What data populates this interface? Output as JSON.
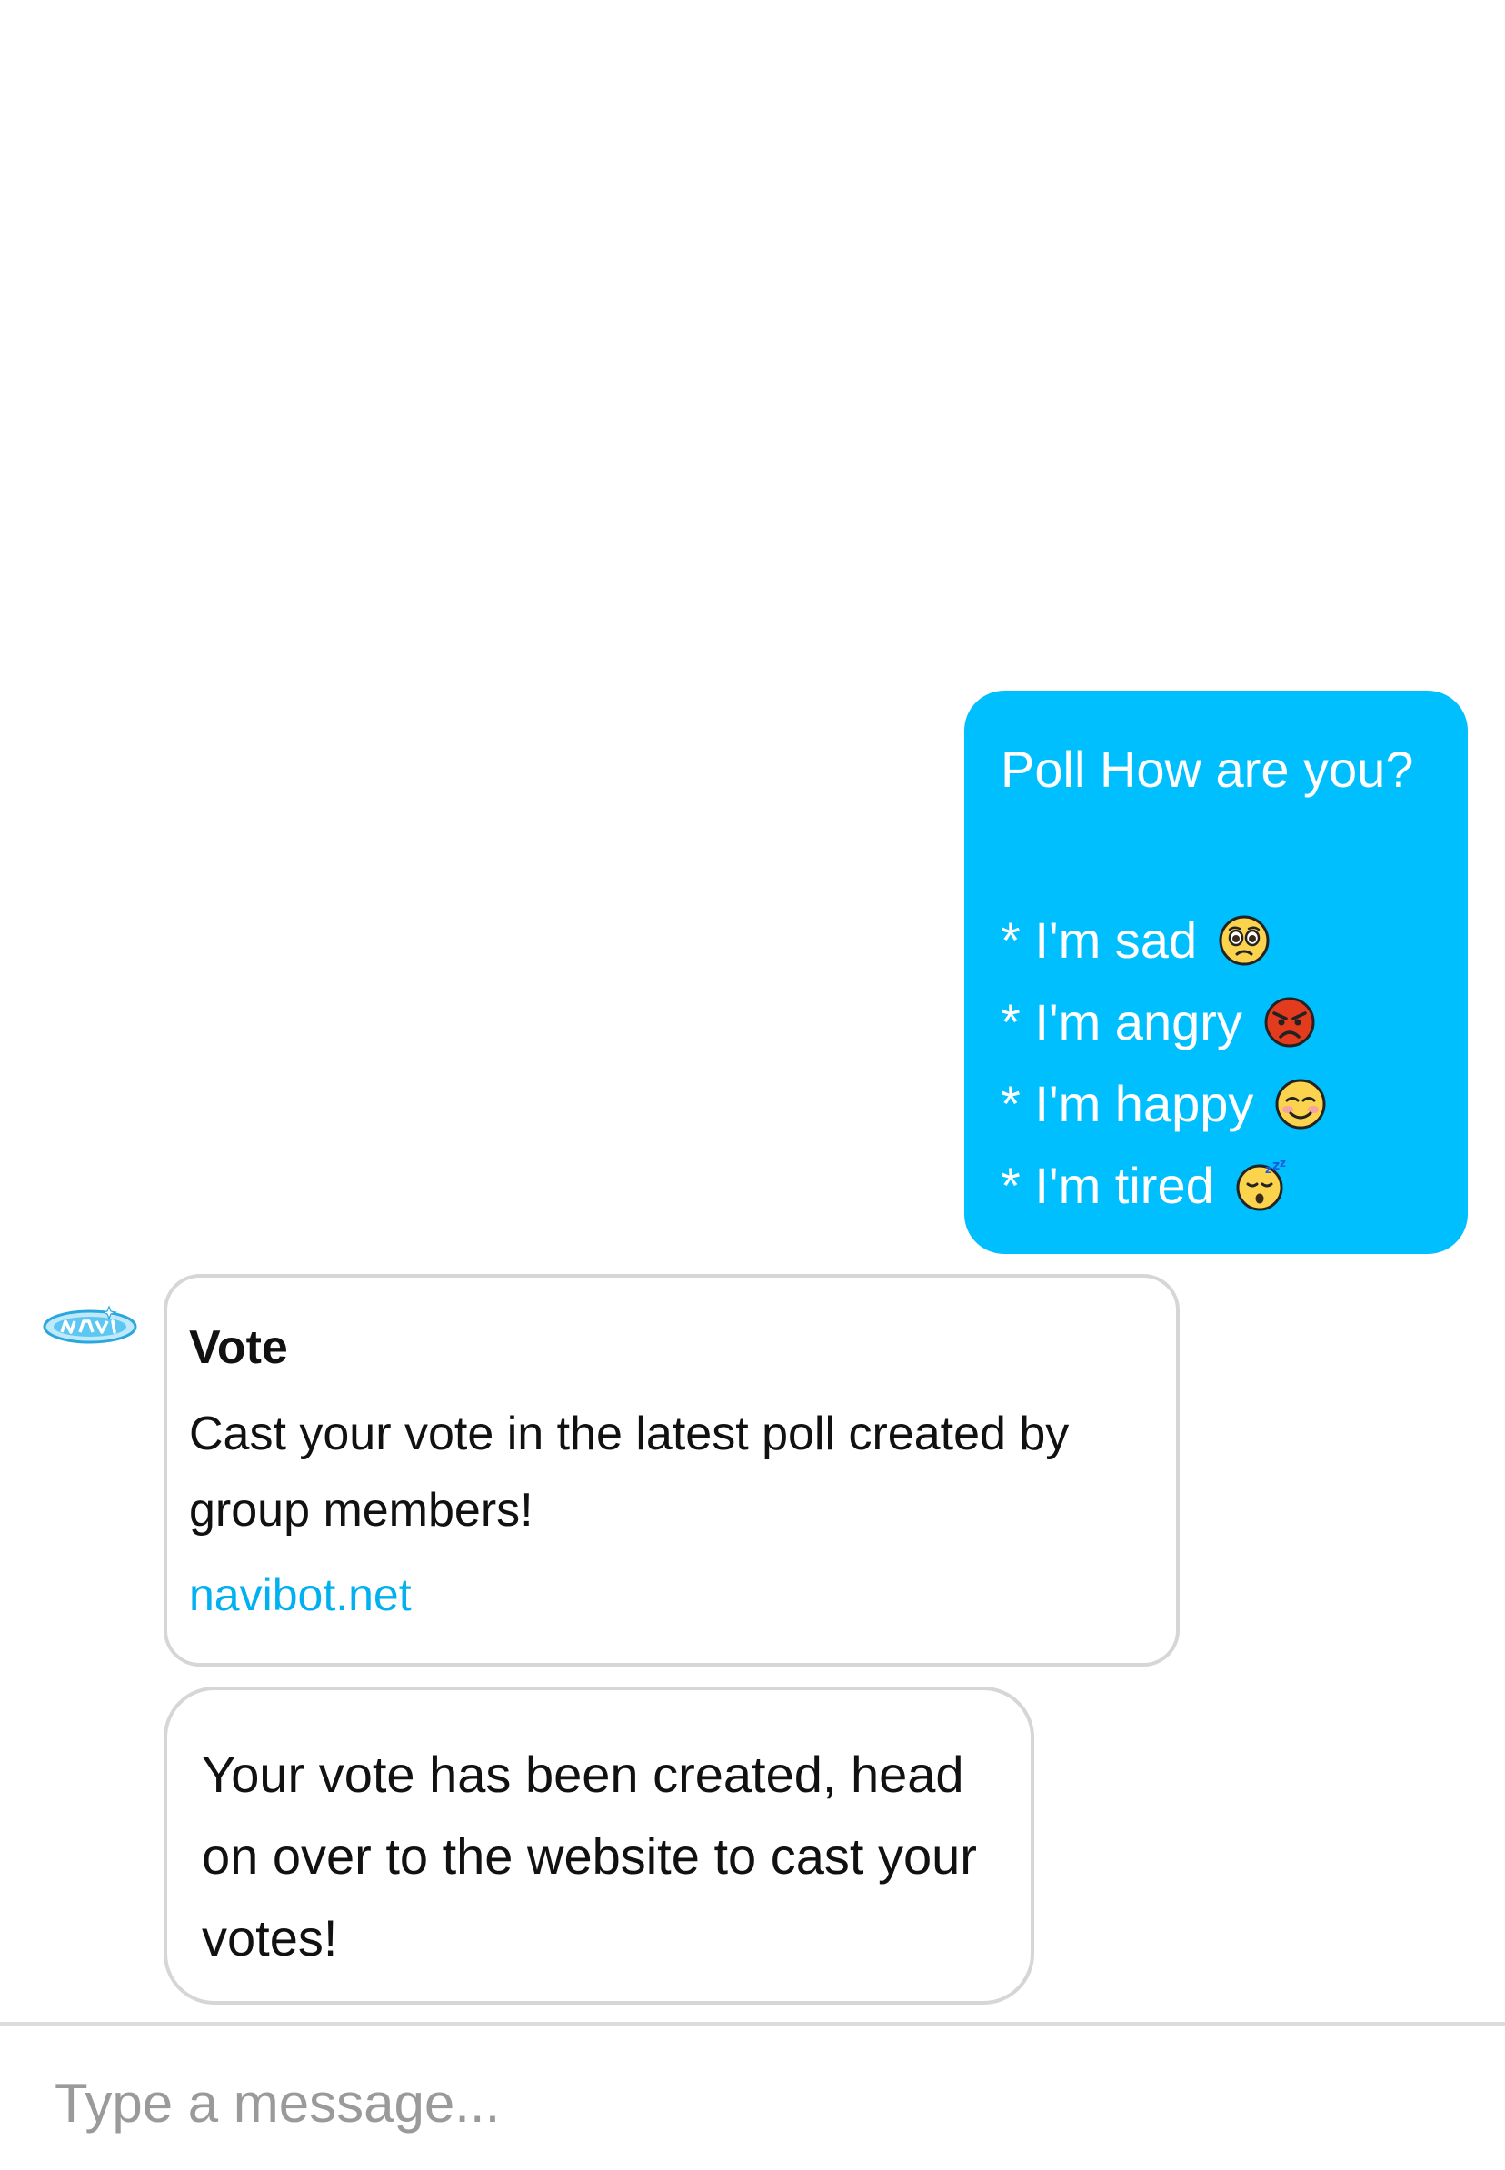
{
  "outgoing_message": {
    "title": "Poll How are you?",
    "options": [
      {
        "label": "* I'm sad",
        "emoji": "pleading-face-icon"
      },
      {
        "label": "* I'm angry",
        "emoji": "angry-face-icon"
      },
      {
        "label": "* I'm happy",
        "emoji": "smiling-face-icon"
      },
      {
        "label": "* I'm tired",
        "emoji": "sleeping-face-icon"
      }
    ]
  },
  "bot": {
    "avatar_icon": "navi-logo-icon",
    "card": {
      "title": "Vote",
      "body": "Cast your vote in the latest poll created by group members!",
      "link": "navibot.net"
    },
    "reply": "Your vote has been created, head on over to the website to cast your votes!"
  },
  "composer": {
    "placeholder": "Type a message..."
  },
  "colors": {
    "outgoing_bubble": "#00bfff",
    "link": "#00b0f0",
    "border": "#d6d6d6"
  }
}
